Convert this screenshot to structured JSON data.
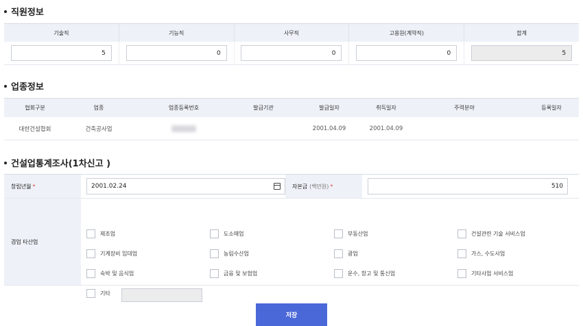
{
  "staff_section": {
    "title": "직원정보",
    "headers": [
      "기술직",
      "기능직",
      "사무직",
      "고용원(계약직)",
      "합계"
    ],
    "values": [
      "5",
      "0",
      "0",
      "0",
      "5"
    ]
  },
  "industry_section": {
    "title": "업종정보",
    "headers": [
      "협회구분",
      "업종",
      "업종등록번호",
      "발급기관",
      "발급일자",
      "취득일자",
      "주력분야",
      "등록일자"
    ],
    "row": {
      "association": "대한건설협회",
      "industry": "건축공사업",
      "reg_no": "",
      "issuer": "",
      "issue_date": "2001.04.09",
      "acquire_date": "2001.04.09",
      "main_field": "",
      "reg_date": ""
    }
  },
  "survey_section": {
    "title": "건설업통계조사(1차신고 )",
    "founding_label": "창립년월",
    "founding_value": "2001.02.24",
    "capital_label": "자본금",
    "capital_unit": "(백만원)",
    "capital_value": "510",
    "required_mark": "*",
    "other_business_label": "겸업 타산업",
    "options": [
      "제조업",
      "도소매업",
      "부동산업",
      "건설관련 기술 서비스업",
      "기계장비 임대업",
      "농림수산업",
      "광업",
      "가스, 수도사업",
      "숙박 및 음식업",
      "금융 및 보험업",
      "운수, 창고 및 통신업",
      "기타사업 서비스업",
      "기타"
    ]
  },
  "save_button": "저장"
}
